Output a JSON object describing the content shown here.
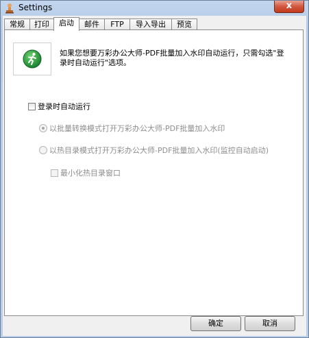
{
  "window": {
    "title": "Settings",
    "close_glyph": "x"
  },
  "tabs": [
    {
      "label": "常规"
    },
    {
      "label": "打印"
    },
    {
      "label": "启动"
    },
    {
      "label": "邮件"
    },
    {
      "label": "FTP"
    },
    {
      "label": "导入导出"
    },
    {
      "label": "预览"
    }
  ],
  "active_tab": "启动",
  "startup": {
    "icon": "running-man-icon",
    "description": "如果您想要万彩办公大师-PDF批量加入水印自动运行，只需勾选\"登录时自动运行\"选项。",
    "auto_run_label": "登录时自动运行",
    "auto_run_checked": false,
    "mode_batch_label": "以批量转换模式打开万彩办公大师-PDF批量加入水印",
    "mode_batch_selected": true,
    "mode_hotfolder_label": "以热目录模式打开万彩办公大师-PDF批量加入水印(监控自动启动)",
    "mode_hotfolder_selected": false,
    "minimize_label": "最小化热目录窗口",
    "minimize_checked": false
  },
  "buttons": {
    "ok": "确定",
    "cancel": "取消"
  },
  "colors": {
    "icon_green": "#1e9e3a",
    "disabled_text": "#8d8d8d"
  }
}
